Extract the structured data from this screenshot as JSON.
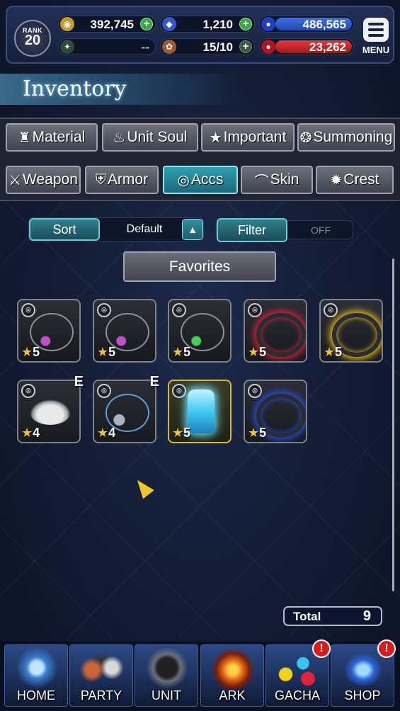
{
  "header": {
    "rank_label": "RANK",
    "rank_value": "20",
    "gil": "392,745",
    "crystals": "1,210",
    "blue_gauge": "486,565",
    "blank_value": "--",
    "stamina": "15/10",
    "red_gauge": "23,262",
    "menu_label": "MENU"
  },
  "page": {
    "title": "Inventory"
  },
  "tabs": {
    "row1": [
      {
        "label": "Material",
        "icon": "sack-icon"
      },
      {
        "label": "Unit Soul",
        "icon": "flame-icon"
      },
      {
        "label": "Important",
        "icon": "star-icon"
      },
      {
        "label": "Summoning",
        "icon": "summon-icon"
      }
    ],
    "row2": [
      {
        "label": "Weapon",
        "icon": "sword-icon"
      },
      {
        "label": "Armor",
        "icon": "armor-icon"
      },
      {
        "label": "Accs",
        "icon": "ring-icon",
        "active": true
      },
      {
        "label": "Skin",
        "icon": "hanger-icon"
      },
      {
        "label": "Crest",
        "icon": "crest-icon"
      }
    ]
  },
  "controls": {
    "sort_label": "Sort",
    "sort_value": "Default",
    "sort_arrow": "▲",
    "filter_label": "Filter",
    "filter_value": "OFF",
    "favorites_label": "Favorites"
  },
  "items": [
    {
      "name": "necklace-1",
      "rarity": "5",
      "equipped": false,
      "color": "#c24ec9"
    },
    {
      "name": "necklace-2",
      "rarity": "5",
      "equipped": false,
      "color": "#c24ec9"
    },
    {
      "name": "necklace-3",
      "rarity": "5",
      "equipped": false,
      "color": "#3ed24e"
    },
    {
      "name": "red-chain-ring",
      "rarity": "5",
      "equipped": false,
      "color": "#e2233b"
    },
    {
      "name": "gold-chain-ring",
      "rarity": "5",
      "equipped": false,
      "color": "#f2c21a"
    },
    {
      "name": "white-hat",
      "rarity": "4",
      "equipped": true,
      "equip_mark": "E",
      "color": "#e9e9ea"
    },
    {
      "name": "blue-pendant",
      "rarity": "4",
      "equipped": true,
      "equip_mark": "E",
      "color": "#5aa0d8"
    },
    {
      "name": "crystal-vial",
      "rarity": "5",
      "equipped": false,
      "color": "#6fe4ff",
      "highlight": true
    },
    {
      "name": "blue-chain-ring",
      "rarity": "5",
      "equipped": false,
      "color": "#2a52e8"
    }
  ],
  "total": {
    "label": "Total",
    "count": "9"
  },
  "nav": [
    {
      "label": "HOME",
      "badge": ""
    },
    {
      "label": "PARTY",
      "badge": ""
    },
    {
      "label": "UNIT",
      "badge": ""
    },
    {
      "label": "ARK",
      "badge": ""
    },
    {
      "label": "GACHA",
      "badge": "!"
    },
    {
      "label": "SHOP",
      "badge": "!"
    }
  ],
  "colors": {
    "accent_teal": "#2fa0b2",
    "plus_green": "#3aa64a",
    "blue_gauge": "#3b6fe8",
    "red_gauge": "#e43a3a",
    "rarity_star": "#f2c230"
  }
}
